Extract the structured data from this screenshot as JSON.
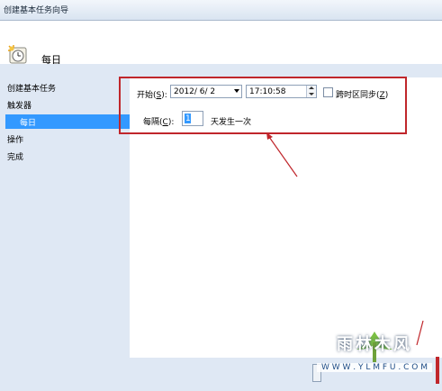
{
  "window": {
    "title": "创建基本任务向导"
  },
  "header": {
    "step_title": "每日",
    "icon": "calendar-clock-icon"
  },
  "nav": {
    "items": [
      {
        "label": "创建基本任务",
        "selected": false
      },
      {
        "label": "触发器",
        "selected": false
      },
      {
        "label": "每日",
        "selected": true
      },
      {
        "label": "操作",
        "selected": false
      },
      {
        "label": "完成",
        "selected": false
      }
    ]
  },
  "form": {
    "start_label": "开始(",
    "start_accel": "S",
    "start_suffix": "):",
    "date_value": "2012/  6/  2",
    "time_value": "17:10:58",
    "tz_label": "跨时区同步(",
    "tz_accel": "Z",
    "tz_suffix": ")",
    "tz_checked": false,
    "interval_label": "每隔(",
    "interval_accel": "C",
    "interval_suffix": "):",
    "interval_value": "1",
    "interval_unit": "天发生一次"
  },
  "watermark": {
    "text": "雨林木风",
    "url": "W W W . Y L M F U . C O M"
  },
  "colors": {
    "accent": "#3399ff",
    "annotation": "#c0262b",
    "content_bg": "#dfe8f4"
  }
}
